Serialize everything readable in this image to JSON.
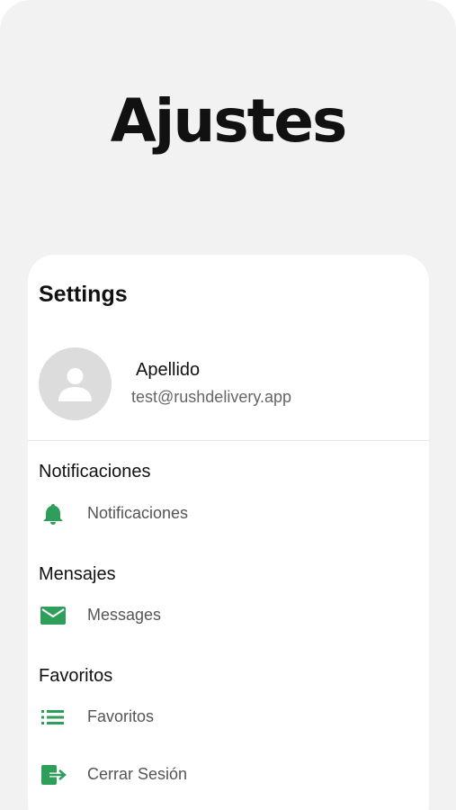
{
  "header": {
    "title": "Ajustes"
  },
  "card": {
    "title": "Settings"
  },
  "profile": {
    "name": "Apellido",
    "email": "test@rushdelivery.app"
  },
  "sections": {
    "notifications": {
      "heading": "Notificaciones",
      "item_label": "Notificaciones",
      "icon": "bell-icon"
    },
    "messages": {
      "heading": "Mensajes",
      "item_label": "Messages",
      "icon": "envelope-icon"
    },
    "favorites": {
      "heading": "Favoritos",
      "item_label": "Favoritos",
      "icon": "list-icon"
    }
  },
  "logout": {
    "label": "Cerrar Sesión",
    "icon": "logout-icon"
  },
  "colors": {
    "accent": "#2e9e5b",
    "background": "#f2f2f2",
    "card": "#ffffff"
  }
}
